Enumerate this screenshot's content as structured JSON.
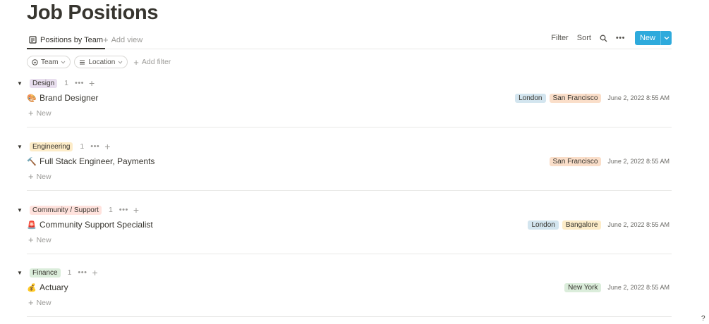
{
  "title": "Job Positions",
  "view": {
    "active_tab": "Positions by Team",
    "add_view": "Add view"
  },
  "toolbar": {
    "filter": "Filter",
    "sort": "Sort",
    "new": "New"
  },
  "filters": {
    "team": "Team",
    "location": "Location",
    "add_filter": "Add filter"
  },
  "groups": [
    {
      "tag": "Design",
      "tag_color": "#e8deee",
      "count": "1",
      "emoji": "🎨",
      "name": "Brand Designer",
      "locations": [
        {
          "label": "London",
          "color": "#d3e5ef"
        },
        {
          "label": "San Francisco",
          "color": "#fadec9"
        }
      ],
      "date": "June 2, 2022 8:55 AM",
      "new_label": "New"
    },
    {
      "tag": "Engineering",
      "tag_color": "#fdecc8",
      "count": "1",
      "emoji": "🔨",
      "name": "Full Stack Engineer, Payments",
      "locations": [
        {
          "label": "San Francisco",
          "color": "#fadec9"
        }
      ],
      "date": "June 2, 2022 8:55 AM",
      "new_label": "New"
    },
    {
      "tag": "Community / Support",
      "tag_color": "#ffe2dd",
      "count": "1",
      "emoji": "🚨",
      "name": "Community Support Specialist",
      "locations": [
        {
          "label": "London",
          "color": "#d3e5ef"
        },
        {
          "label": "Bangalore",
          "color": "#fdecc8"
        }
      ],
      "date": "June 2, 2022 8:55 AM",
      "new_label": "New"
    },
    {
      "tag": "Finance",
      "tag_color": "#dbeddb",
      "count": "1",
      "emoji": "💰",
      "name": "Actuary",
      "locations": [
        {
          "label": "New York",
          "color": "#dbeddb"
        }
      ],
      "date": "June 2, 2022 8:55 AM",
      "new_label": "New"
    }
  ],
  "colors": {
    "accent": "#2eaadc",
    "text": "#37352f",
    "muted": "#9b9a97",
    "divider": "#e9e9e7"
  }
}
